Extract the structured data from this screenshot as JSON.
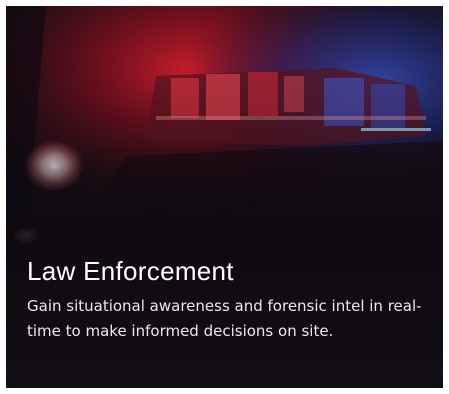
{
  "card": {
    "title": "Law Enforcement",
    "description": "Gain situational awareness and forensic intel in real-time to make informed decisions on site."
  },
  "colors": {
    "card_background": "#120c14",
    "title_text": "#ffffff",
    "body_text": "#ece8ee",
    "light_red": "#d81a2a",
    "light_blue": "#2b3fa8"
  }
}
